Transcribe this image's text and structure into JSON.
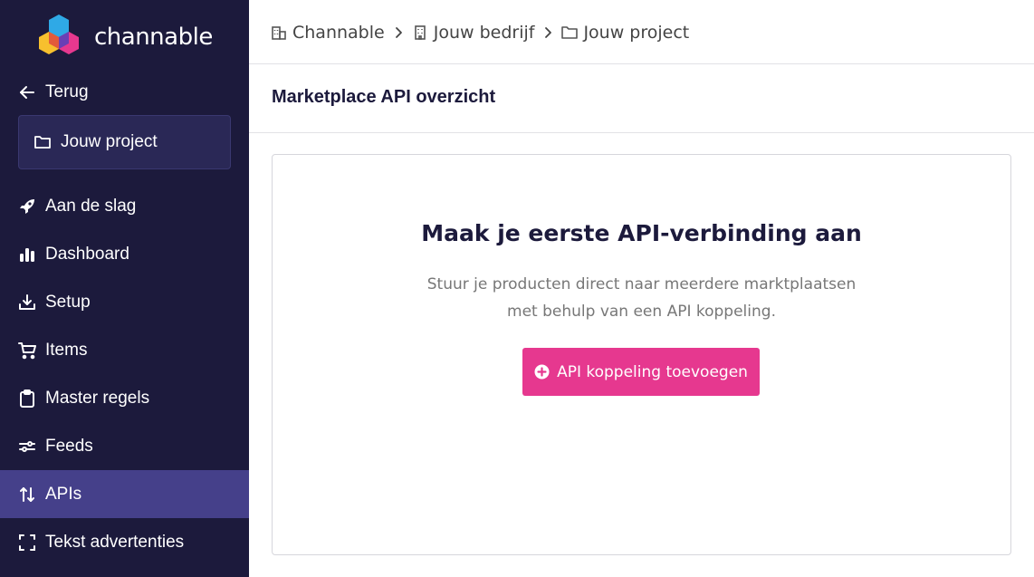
{
  "brand": {
    "name": "channable"
  },
  "sidebar": {
    "back_label": "Terug",
    "project_label": "Jouw project",
    "items": [
      {
        "label": "Aan de slag",
        "icon": "rocket-icon"
      },
      {
        "label": "Dashboard",
        "icon": "bar-chart-icon"
      },
      {
        "label": "Setup",
        "icon": "download-icon"
      },
      {
        "label": "Items",
        "icon": "cart-icon"
      },
      {
        "label": "Master regels",
        "icon": "clipboard-icon"
      },
      {
        "label": "Feeds",
        "icon": "sliders-icon"
      },
      {
        "label": "APIs",
        "icon": "arrows-updown-icon",
        "active": true
      },
      {
        "label": "Tekst advertenties",
        "icon": "frame-icon"
      }
    ]
  },
  "breadcrumb": {
    "items": [
      {
        "label": "Channable",
        "icon": "buildings-icon"
      },
      {
        "label": "Jouw bedrijf",
        "icon": "building-icon"
      },
      {
        "label": "Jouw project",
        "icon": "folder-icon"
      }
    ]
  },
  "main": {
    "title": "Marketplace API overzicht",
    "empty_state": {
      "heading": "Maak je eerste API-verbinding aan",
      "line1": "Stuur je producten direct naar meerdere marktplaatsen",
      "line2": "met behulp van een API koppeling.",
      "button_label": "API koppeling toevoegen"
    }
  },
  "colors": {
    "sidebar_bg": "#1c1a3c",
    "active_item_bg": "#45408a",
    "accent": "#e6388f"
  }
}
